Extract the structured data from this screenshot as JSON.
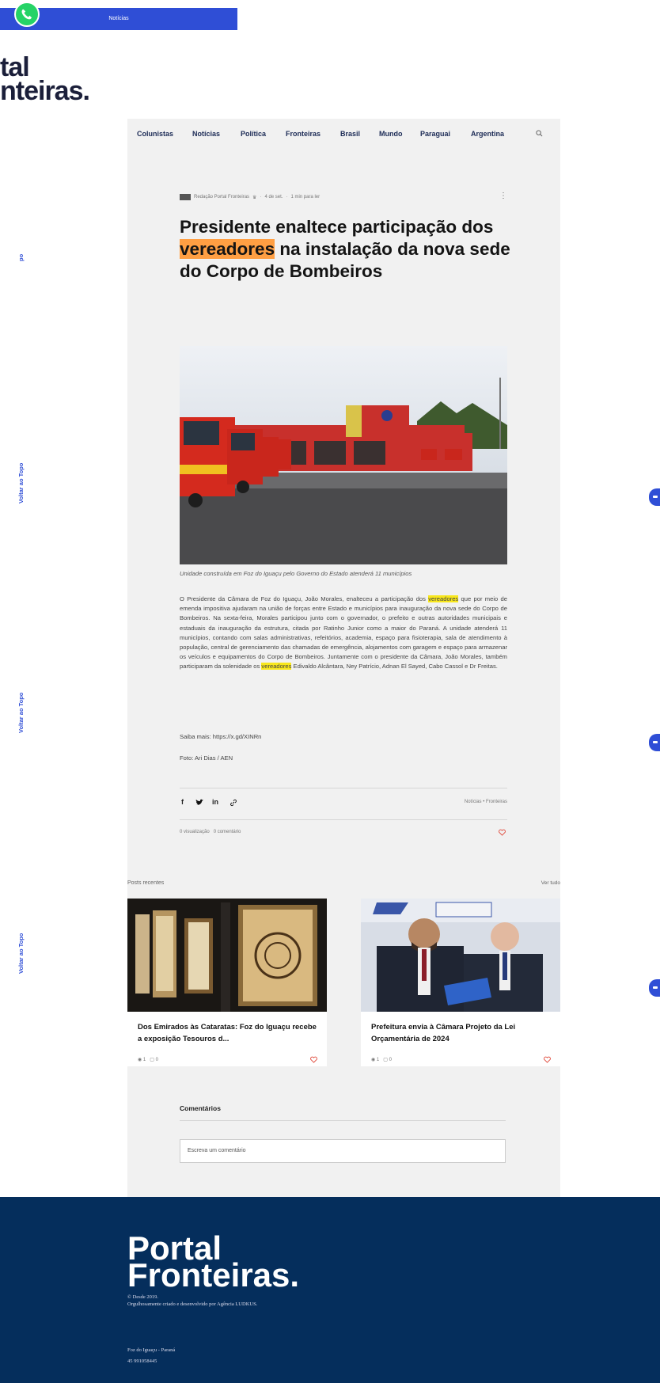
{
  "topbar": {
    "label": "Notícias"
  },
  "logo_partial": {
    "line1": "tal",
    "line2": "nteiras."
  },
  "side": {
    "back_to_top": "Voltar ao Topo",
    "short": "po"
  },
  "nav": {
    "items": [
      "Colunistas",
      "Notícias",
      "Política",
      "Fronteiras",
      "Brasil",
      "Mundo",
      "Paraguai",
      "Argentina"
    ]
  },
  "post": {
    "author": "Redação Portal Fronteiras",
    "date": "4 de set.",
    "read_time": "1 min para ler",
    "title_a": "Presidente enaltece participação dos ",
    "title_hl": "vereadores",
    "title_b": " na instalação da nova sede do Corpo de Bombeiros",
    "caption": "Unidade construída em Foz do Iguaçu pelo Governo do Estado atenderá 11 municípios",
    "body_a": "O Presidente da Câmara de Foz do Iguaçu, João Morales, enalteceu a participação dos ",
    "body_hl1": "vereadores",
    "body_b": " que por meio de emenda impositiva ajudaram na união de forças entre Estado e municípios para inauguração da nova sede do Corpo de Bombeiros. Na sexta-feira, Morales participou junto com o governador, o prefeito e outras autoridades municipais e estaduais da inauguração da estrutura, citada por Ratinho Junior como a maior do Paraná. A unidade atenderá 11 municípios, contando com salas administrativas, refeitórios, academia, espaço para fisioterapia, sala de atendimento à população, central de gerenciamento das chamadas de emergência, alojamentos com garagem e espaço para armazenar os veículos e equipamentos do Corpo de Bombeiros. Juntamente com o presidente da Câmara, João Morales, também participaram da solenidade os ",
    "body_hl2": "vereadores",
    "body_c": " Edivaldo Alcântara, Ney Patrício, Adnan El Sayed, Cabo Cassol e Dr Freitas.",
    "more": "Saiba mais: https://x.gd/XINRn",
    "photo_credit": "Foto: Ari Dias / AEN",
    "categories": "Notícias • Fronteiras",
    "views": "0 visualização",
    "comments": "0 comentário"
  },
  "recent": {
    "label": "Posts recentes",
    "see_all": "Ver tudo",
    "cards": [
      {
        "title": "Dos Emirados às Cataratas: Foz do Iguaçu recebe a exposição Tesouros d...",
        "views": "1",
        "comments": "0"
      },
      {
        "title": "Prefeitura envia à Câmara Projeto da Lei Orçamentária de 2024",
        "views": "1",
        "comments": "0"
      }
    ]
  },
  "comments_section": {
    "title": "Comentários",
    "placeholder": "Escreva um comentário"
  },
  "footer": {
    "logo_line1": "Portal",
    "logo_line2": "Fronteiras.",
    "copy1": "© Desde 2019.",
    "copy2": "Orgulhosamente criado e desenvolvido por Agência LUDKUS.",
    "city": "Foz do Iguaçu - Paraná",
    "phone": "45 991058445"
  },
  "colors": {
    "brand_blue": "#2f4ed6",
    "footer_navy": "#052e5c",
    "highlight_orange": "#ff9f43",
    "highlight_yellow": "#f8e71c",
    "whatsapp": "#25d366"
  }
}
